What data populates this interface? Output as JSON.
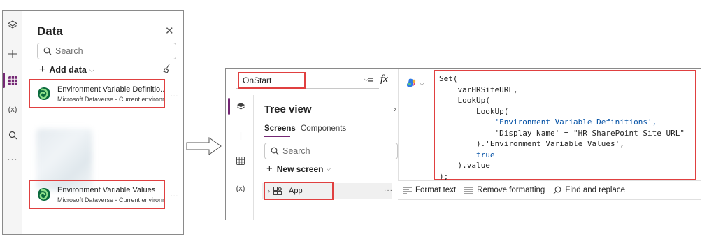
{
  "data_panel": {
    "title": "Data",
    "close_glyph": "✕",
    "search_placeholder": "Search",
    "add_data_label": "Add data",
    "items": [
      {
        "name": "Environment Variable Definitio...",
        "source": "Microsoft Dataverse - Current environm..."
      },
      {
        "name": "Environment Variable Values",
        "source": "Microsoft Dataverse - Current environm..."
      }
    ],
    "more_glyph": "...",
    "rail_icons": [
      "layers-icon",
      "plus-icon",
      "data-grid-icon",
      "variables-icon",
      "search-icon",
      "more-icon"
    ]
  },
  "formula_bar": {
    "property": "OnStart",
    "equals": "=",
    "fx": "fx",
    "code_lines": [
      "Set(",
      "    varHRSiteURL,",
      "    LookUp(",
      "        LookUp(",
      "            'Environment Variable Definitions',",
      "            'Display Name' = \"HR SharePoint Site URL\"",
      "        ).'Environment Variable Values',",
      "        true",
      "    ).value",
      ");"
    ]
  },
  "tree_view": {
    "title": "Tree view",
    "tab_screens": "Screens",
    "tab_components": "Components",
    "search_placeholder": "Search",
    "new_screen_label": "New screen",
    "app_item_label": "App",
    "more_glyph": "···"
  },
  "bottom_toolbar": {
    "format_text": "Format text",
    "remove_formatting": "Remove formatting",
    "find_replace": "Find and replace"
  },
  "colors": {
    "highlight": "#e04040",
    "accent": "#742774"
  }
}
